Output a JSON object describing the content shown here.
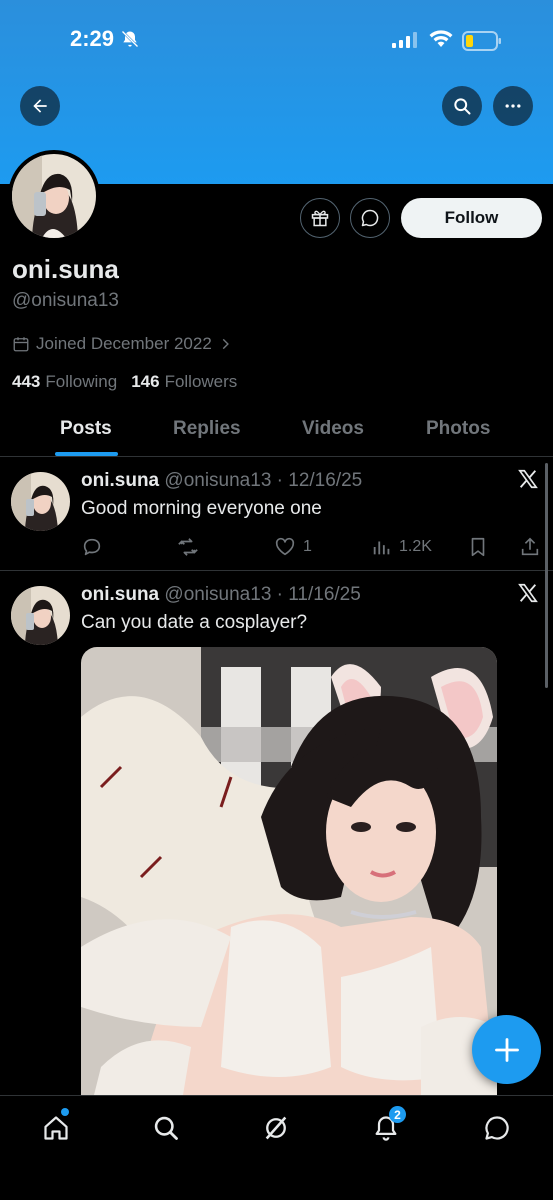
{
  "status_bar": {
    "time": "2:29",
    "battery_level": 0.2
  },
  "profile": {
    "display_name": "oni.suna",
    "handle": "@onisuna13",
    "joined": "Joined December 2022",
    "following_count": "443",
    "following_label": "Following",
    "followers_count": "146",
    "followers_label": "Followers"
  },
  "header": {
    "follow_label": "Follow"
  },
  "tabs": [
    {
      "label": "Posts",
      "active": true
    },
    {
      "label": "Replies",
      "active": false
    },
    {
      "label": "Videos",
      "active": false
    },
    {
      "label": "Photos",
      "active": false
    }
  ],
  "posts": [
    {
      "name": "oni.suna",
      "meta": "@onisuna13 · 12/16/25",
      "text": "Good morning everyone one",
      "likes": "1",
      "views": "1.2K"
    },
    {
      "name": "oni.suna",
      "meta": "@onisuna13 · 11/16/25",
      "text": "Can you date a cosplayer?"
    }
  ],
  "nav": {
    "notifications_badge": "2"
  },
  "colors": {
    "accent": "#1d9bf0",
    "banner": "#1d9bf0",
    "background": "#000000",
    "muted": "#71767b"
  },
  "icons": [
    "back-arrow-icon",
    "search-icon",
    "more-icon",
    "gift-icon",
    "message-icon",
    "calendar-icon",
    "chevron-right-icon",
    "x-logo-icon",
    "reply-icon",
    "repost-icon",
    "like-icon",
    "views-icon",
    "bookmark-icon",
    "share-icon",
    "compose-plus-icon",
    "home-icon",
    "explore-icon",
    "grok-icon",
    "bell-icon",
    "chat-icon"
  ]
}
